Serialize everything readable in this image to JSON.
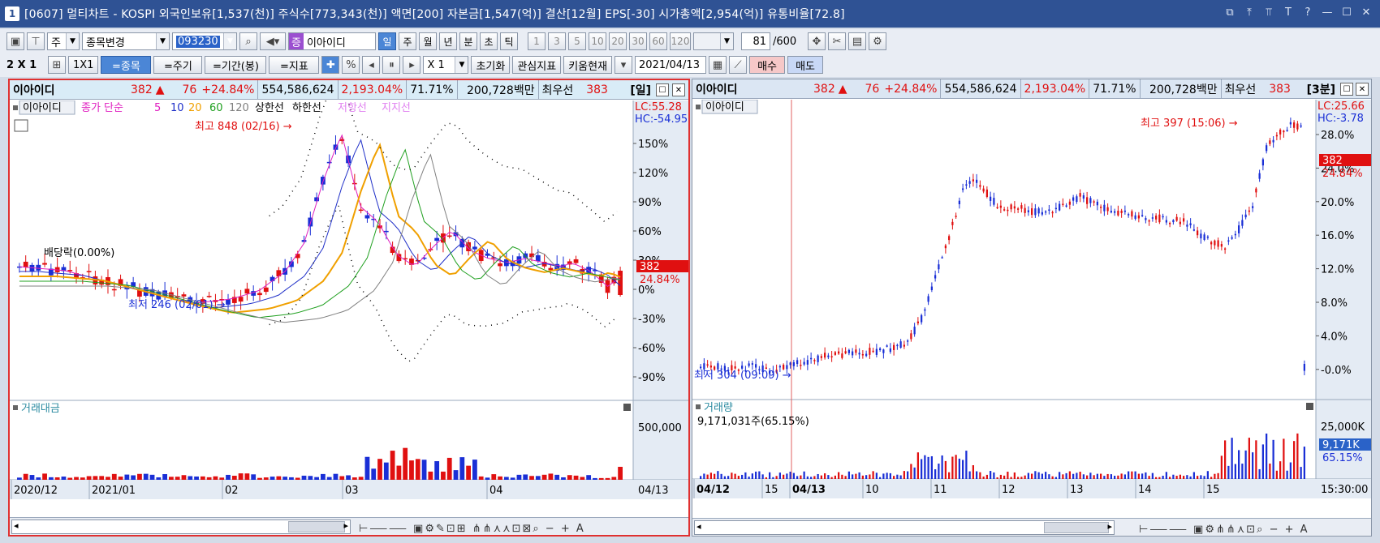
{
  "window": {
    "number": "1",
    "title": "[0607] 멀티차트 - KOSPI 외국인보유[1,537(천)] 주식수[773,343(천)] 액면[200] 자본금[1,547(억)] 결산[12월] EPS[-30] 시가총액[2,954(억)] 유통비율[72.8]",
    "controls": [
      "⧉",
      "⤒",
      "⫪",
      "T",
      "?",
      "—",
      "☐",
      "✕"
    ]
  },
  "toolbar1": {
    "ju_label": "주",
    "stock_change": "종목변경",
    "code_value": "093230",
    "stock_badge": "증",
    "stock_name": "이아이디",
    "periods": [
      "일",
      "주",
      "월",
      "년",
      "분",
      "초",
      "틱"
    ],
    "selected_period": "일",
    "numbers": [
      "1",
      "3",
      "5",
      "10",
      "20",
      "30",
      "60",
      "120"
    ],
    "count_value": "81",
    "count_total": "/600"
  },
  "toolbar2": {
    "grid_label": "2 X 1",
    "one_by_one": "1X1",
    "stock_btn": "=종목",
    "period_btn": "=주기",
    "range_btn": "=기간(봉)",
    "indicator_btn": "=지표",
    "percent": "%",
    "multiplier": "X 1",
    "reset": "초기화",
    "interest": "관심지표",
    "kiwoom": "키움현재",
    "date": "2021/04/13",
    "buy": "매수",
    "sell": "매도"
  },
  "left_pane": {
    "name": "이아이디",
    "price": "382",
    "arrow": "▲",
    "change": "76",
    "change_pct": "+24.84%",
    "volume": "554,586,624",
    "vol_pct": "2,193.04%",
    "ratio": "71.71%",
    "amount": "200,728백만",
    "quote_label": "최우선",
    "quote": "383",
    "period_tag": "[일]",
    "legend": {
      "name": "이아이디",
      "ma_label": "종가 단순",
      "ma_values": [
        "5",
        "10",
        "20",
        "60",
        "120"
      ],
      "upper": "상한선",
      "lower": "하한선",
      "resist": "저항선",
      "support": "지지선"
    },
    "lc": "LC:55.28",
    "hc": "HC:-54.95",
    "high_note": "최고 848 (02/16)",
    "low_note": "최저 246 (02/01)",
    "dividend": "배당락(0.00%)",
    "price_tag": "382",
    "price_tag_pct": "24.84%",
    "vol_title": "거래대금",
    "vol_axis": "500,000",
    "xlabels": [
      "2020/12",
      "2021/01",
      "02",
      "03",
      "04"
    ],
    "x_end": "04/13"
  },
  "right_pane": {
    "name": "이아이디",
    "price": "382",
    "arrow": "▲",
    "change": "76",
    "change_pct": "+24.84%",
    "volume": "554,586,624",
    "vol_pct": "2,193.04%",
    "ratio": "71.71%",
    "amount": "200,728백만",
    "quote_label": "최우선",
    "quote": "383",
    "period_tag": "[3분]",
    "legend_name": "이아이디",
    "lc": "LC:25.66",
    "hc": "HC:-3.78",
    "high_note": "최고 397 (15:06)",
    "low_note": "최저 304 (09:09)",
    "price_tag": "382",
    "price_tag_pct": "24.84%",
    "vol_title": "거래량",
    "vol_note": "9,171,031주(65.15%)",
    "vol_axis": "25,000K",
    "vol_tag": "9,171K",
    "vol_tag_pct": "65.15%",
    "xlabels": [
      "04/12",
      "15",
      "04/13",
      "10",
      "11",
      "12",
      "13",
      "14",
      "15"
    ],
    "x_end": "15:30:00"
  },
  "left_axis": [
    "150%",
    "120%",
    "90%",
    "60%",
    "30%",
    "0%",
    "-30%",
    "-60%",
    "-90%"
  ],
  "right_axis": [
    "28.0%",
    "24.0%",
    "20.0%",
    "16.0%",
    "12.0%",
    "8.0%",
    "4.0%",
    "-0.0%"
  ],
  "colors": {
    "up": "#e01010",
    "down": "#1a2fd6",
    "ma5": "#e020c0",
    "ma10": "#2030c8",
    "ma20": "#f0a000",
    "ma60": "#20a020",
    "ma120": "#808080",
    "title_bg": "#2f5294"
  }
}
